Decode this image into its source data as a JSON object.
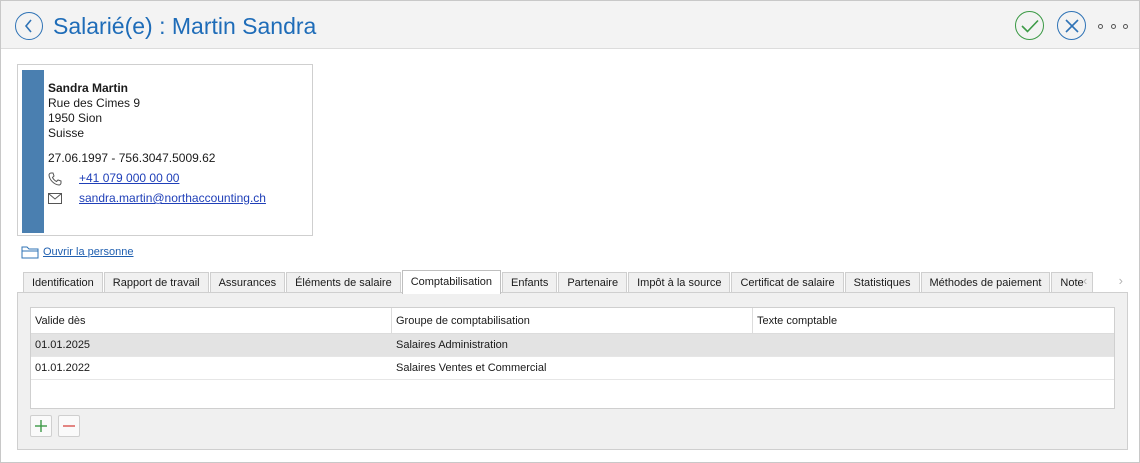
{
  "header": {
    "title": "Salarié(e) : Martin Sandra",
    "back_icon": "chevron-left-icon",
    "ok_icon": "check-icon",
    "cancel_icon": "close-icon",
    "more_icon": "more-dots-icon",
    "colors": {
      "title": "#1e6cb8",
      "ok": "#3c9a46",
      "cancel": "#2f73b6"
    }
  },
  "card": {
    "name": "Sandra Martin",
    "street": "Rue des Cimes 9",
    "city": "1950 Sion",
    "country": "Suisse",
    "dob_ssn": "27.06.1997 - 756.3047.5009.62",
    "phone": "+41 079 000 00 00",
    "email": "sandra.martin@northaccounting.ch",
    "accent_color": "#4a7fb0"
  },
  "open_person": {
    "label": "Ouvrir la personne",
    "icon": "folder-icon"
  },
  "tabs": [
    {
      "label": "Identification"
    },
    {
      "label": "Rapport de travail"
    },
    {
      "label": "Assurances"
    },
    {
      "label": "Éléments de salaire"
    },
    {
      "label": "Comptabilisation",
      "active": true
    },
    {
      "label": "Enfants"
    },
    {
      "label": "Partenaire"
    },
    {
      "label": "Impôt à la source"
    },
    {
      "label": "Certificat de salaire"
    },
    {
      "label": "Statistiques"
    },
    {
      "label": "Méthodes de paiement"
    },
    {
      "label": "Note"
    }
  ],
  "tab_scroll": {
    "prev": "‹",
    "next": "›"
  },
  "grid": {
    "columns": [
      "Valide dès",
      "Groupe de comptabilisation",
      "Texte comptable"
    ],
    "rows": [
      {
        "valid_from": "01.01.2025",
        "group": "Salaires Administration",
        "text": "",
        "selected": true
      },
      {
        "valid_from": "01.01.2022",
        "group": "Salaires Ventes et Commercial",
        "text": ""
      }
    ]
  },
  "actions": {
    "add_icon": "plus-icon",
    "remove_icon": "minus-icon"
  }
}
